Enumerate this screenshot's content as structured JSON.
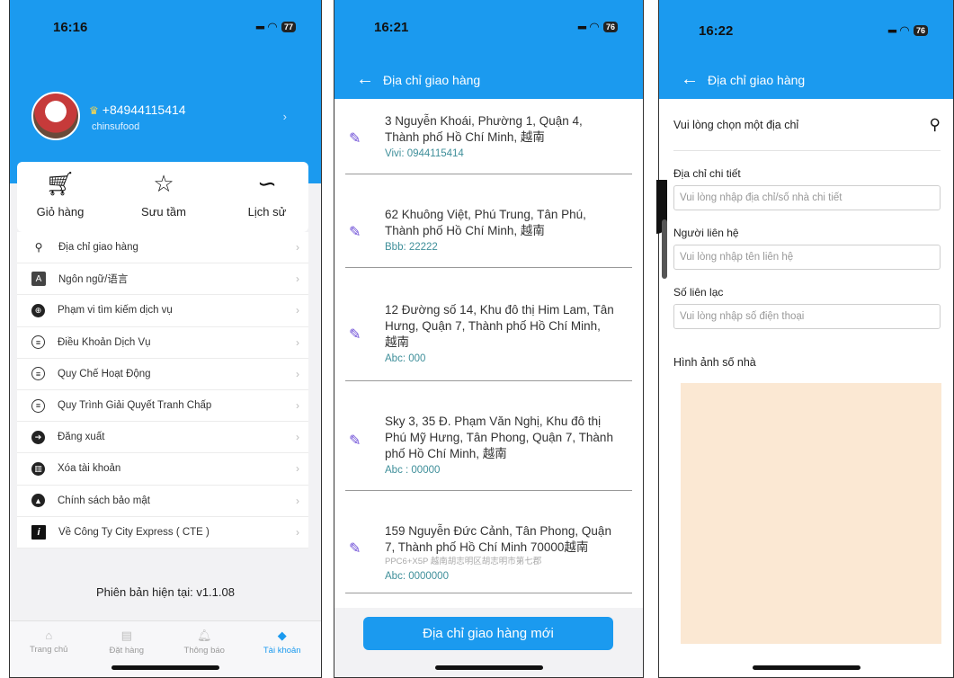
{
  "screen1": {
    "time": "16:16",
    "battery": "77",
    "phone": "+84944115414",
    "username": "chinsufood",
    "quick": [
      {
        "label": "Giỏ hàng",
        "icon": "cart-icon"
      },
      {
        "label": "Sưu tầm",
        "icon": "star-icon"
      },
      {
        "label": "Lịch sử",
        "icon": "footprint-icon"
      }
    ],
    "menu": [
      {
        "label": "Địa chỉ giao hàng",
        "icon": "location-pin-icon"
      },
      {
        "label": "Ngôn ngữ/语言",
        "icon": "language-icon"
      },
      {
        "label": "Phạm vi tìm kiếm dịch vụ",
        "icon": "globe-icon"
      },
      {
        "label": "Điều Khoản Dịch Vụ",
        "icon": "list-icon"
      },
      {
        "label": "Quy Chế Hoạt Động",
        "icon": "list-icon"
      },
      {
        "label": "Quy Trình Giải Quyết Tranh Chấp",
        "icon": "list-icon"
      },
      {
        "label": "Đăng xuất",
        "icon": "logout-icon"
      },
      {
        "label": "Xóa tài khoản",
        "icon": "trash-icon"
      },
      {
        "label": "Chính sách bảo mật",
        "icon": "lock-icon"
      },
      {
        "label": "Về Công Ty City Express ( CTE )",
        "icon": "info-icon"
      }
    ],
    "version": "Phiên bản hiện tại: v1.1.08",
    "tabs": [
      {
        "label": "Trang chủ",
        "icon": "home-icon",
        "active": false
      },
      {
        "label": "Đặt hàng",
        "icon": "order-icon",
        "active": false
      },
      {
        "label": "Thông báo",
        "icon": "bell-icon",
        "active": false
      },
      {
        "label": "Tài khoản",
        "icon": "diamond-icon",
        "active": true
      }
    ]
  },
  "screen2": {
    "time": "16:21",
    "battery": "76",
    "title": "Địa chỉ giao hàng",
    "addresses": [
      {
        "text": "3 Nguyễn Khoái, Phường 1, Quận 4, Thành phố Hồ Chí Minh, 越南",
        "sub": "",
        "contact": "Vivi: 0944115414"
      },
      {
        "text": "62 Khuông Việt, Phú Trung, Tân Phú, Thành phố Hồ Chí Minh, 越南",
        "sub": "",
        "contact": "Bbb: 22222"
      },
      {
        "text": "12 Đường số 14, Khu đô thị Him Lam, Tân Hưng, Quận 7, Thành phố Hồ Chí Minh, 越南",
        "sub": "",
        "contact": "Abc: 000"
      },
      {
        "text": "Sky 3, 35 Đ. Phạm Văn Nghị, Khu đô thị Phú Mỹ Hưng, Tân Phong, Quận 7, Thành phố Hồ Chí Minh, 越南",
        "sub": "",
        "contact": "Abc : 00000"
      },
      {
        "text": "159 Nguyễn Đức Cảnh, Tân Phong, Quận 7, Thành phố Hồ Chí Minh 70000越南",
        "sub": "PPC6+X5P 越南胡志明区胡志明市第七郡",
        "contact": "Abc: 0000000"
      }
    ],
    "new_button": "Địa chỉ giao hàng mới"
  },
  "screen3": {
    "time": "16:22",
    "battery": "76",
    "title": "Địa chỉ giao hàng",
    "choose": "Vui lòng chọn một địa chỉ",
    "fields": [
      {
        "label": "Địa chỉ chi tiết",
        "placeholder": "Vui lòng nhập địa chỉ/số nhà chi tiết"
      },
      {
        "label": "Người liên hệ",
        "placeholder": "Vui lòng nhập tên liên hệ"
      },
      {
        "label": "Số liên lạc",
        "placeholder": "Vui lòng nhập số điện thoại"
      }
    ],
    "photo_label": "Hình ảnh số nhà"
  }
}
